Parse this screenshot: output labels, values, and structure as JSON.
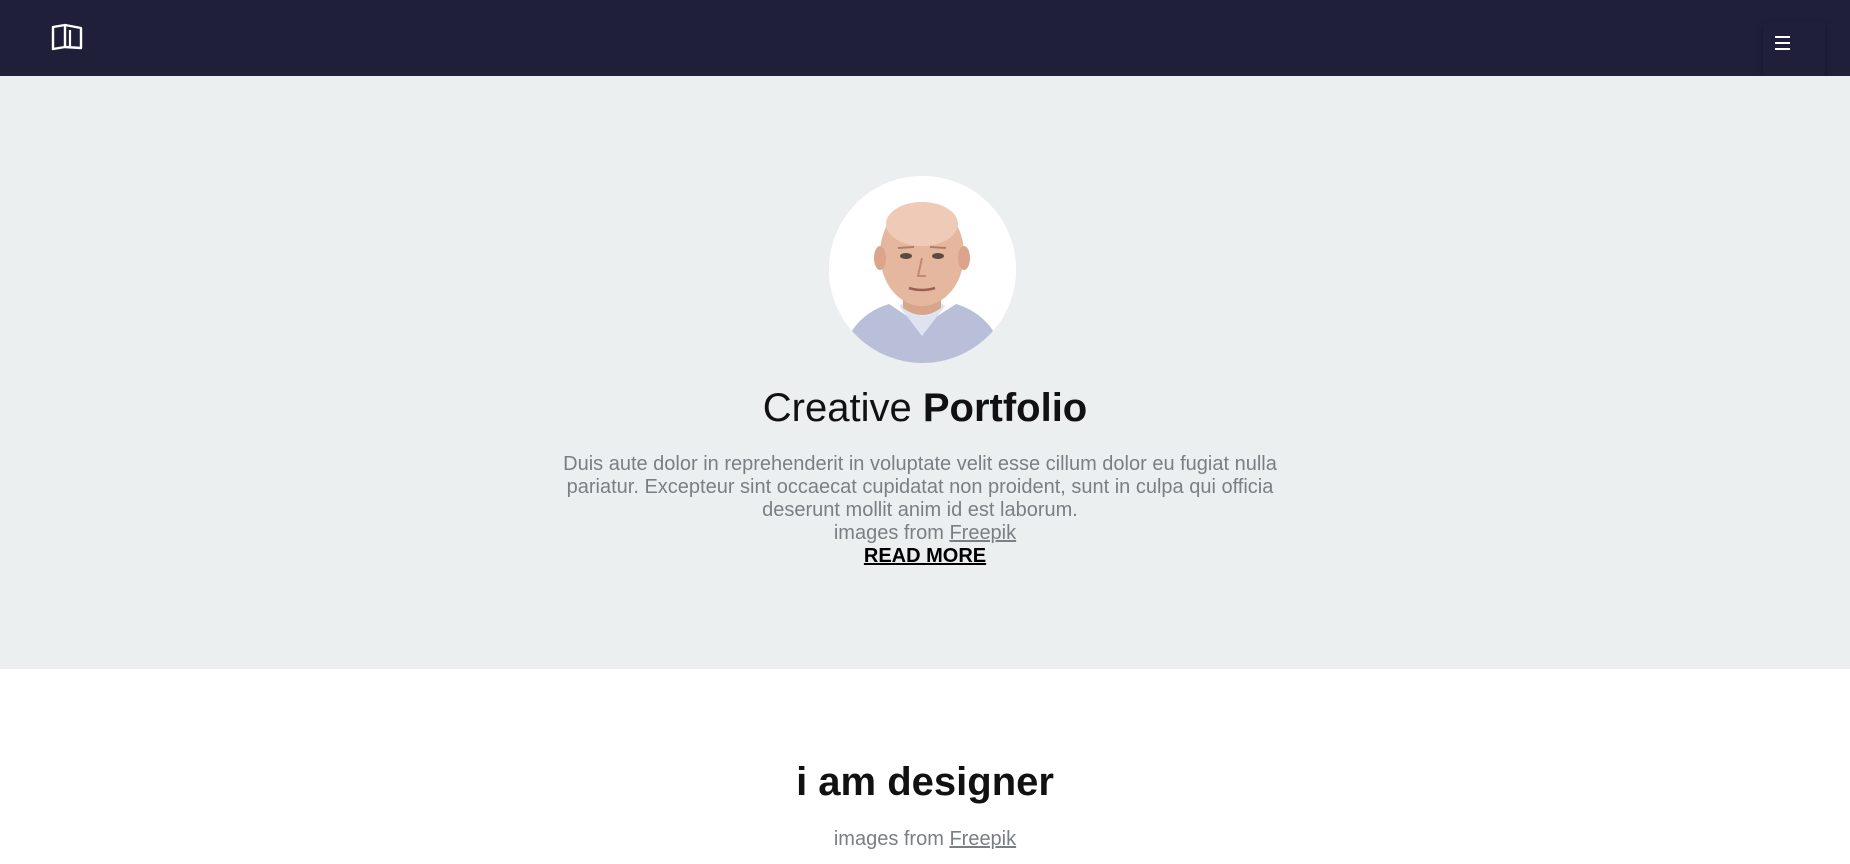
{
  "nav": {
    "logo_icon": "open-book-icon",
    "menu_icon": "hamburger-icon"
  },
  "hero": {
    "title_light": "Creative",
    "title_bold": "Portfolio",
    "description": "Duis aute dolor in reprehenderit in voluptate velit esse cillum dolor eu fugiat nulla pariatur. Excepteur sint occaecat cupidatat non proident, sunt in culpa qui officia deserunt mollit anim id est laborum.",
    "credit_prefix": "images from",
    "credit_link": "Freepik",
    "read_more": "READ MORE"
  },
  "about": {
    "title": "i am designer",
    "credit_prefix": "images from",
    "credit_link": "Freepik"
  },
  "colors": {
    "navbar": "#1f1f3a",
    "hero_bg": "#ebeff0",
    "muted_text": "#7a7f84"
  }
}
